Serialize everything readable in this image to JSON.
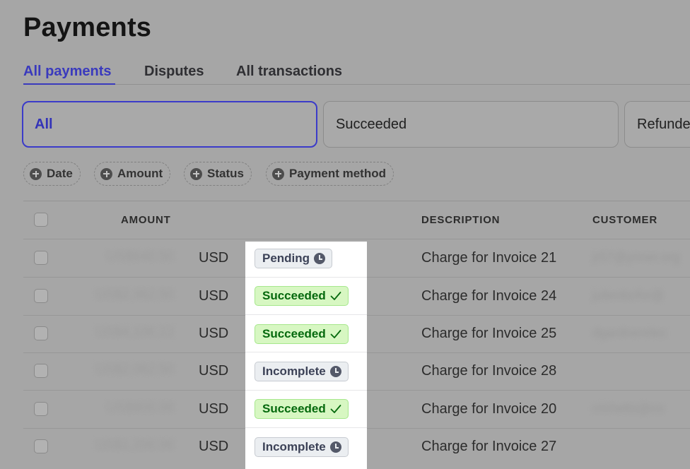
{
  "page": {
    "title": "Payments"
  },
  "tabs": [
    {
      "label": "All payments",
      "active": true
    },
    {
      "label": "Disputes",
      "active": false
    },
    {
      "label": "All transactions",
      "active": false
    }
  ],
  "segments": [
    {
      "label": "All",
      "active": true
    },
    {
      "label": "Succeeded",
      "active": false
    },
    {
      "label": "Refunded",
      "active": false
    }
  ],
  "filters": [
    {
      "label": "Date",
      "icon": "plus-circle-icon"
    },
    {
      "label": "Amount",
      "icon": "plus-circle-icon"
    },
    {
      "label": "Status",
      "icon": "plus-circle-icon"
    },
    {
      "label": "Payment method",
      "icon": "plus-circle-icon"
    }
  ],
  "table": {
    "headers": {
      "amount": "AMOUNT",
      "description": "DESCRIPTION",
      "customer": "CUSTOMER"
    },
    "rows": [
      {
        "amount": "US$640.50",
        "currency": "USD",
        "status": "Pending",
        "status_kind": "pending",
        "description": "Charge for Invoice 21",
        "customer": "jr57@ynner.org"
      },
      {
        "amount": "US$2,362.50",
        "currency": "USD",
        "status": "Succeeded",
        "status_kind": "succeeded",
        "description": "Charge for Invoice 24",
        "customer": "julienbofor@"
      },
      {
        "amount": "US$4,106.22",
        "currency": "USD",
        "status": "Succeeded",
        "status_kind": "succeeded",
        "description": "Charge for Invoice 25",
        "customer": "dgardnerelec"
      },
      {
        "amount": "US$2,062.50",
        "currency": "USD",
        "status": "Incomplete",
        "status_kind": "incomplete",
        "description": "Charge for Invoice 28",
        "customer": ""
      },
      {
        "amount": "US$900.00",
        "currency": "USD",
        "status": "Succeeded",
        "status_kind": "succeeded",
        "description": "Charge for Invoice 20",
        "customer": "rrichetts@co"
      },
      {
        "amount": "US$1,200.00",
        "currency": "USD",
        "status": "Incomplete",
        "status_kind": "incomplete",
        "description": "Charge for Invoice 27",
        "customer": ""
      }
    ]
  },
  "colors": {
    "accent": "#3a3abd",
    "succeeded_bg": "#d7f7c2",
    "succeeded_text": "#05690d",
    "neutral_bg": "#ebeef1",
    "neutral_text": "#3c4257"
  }
}
